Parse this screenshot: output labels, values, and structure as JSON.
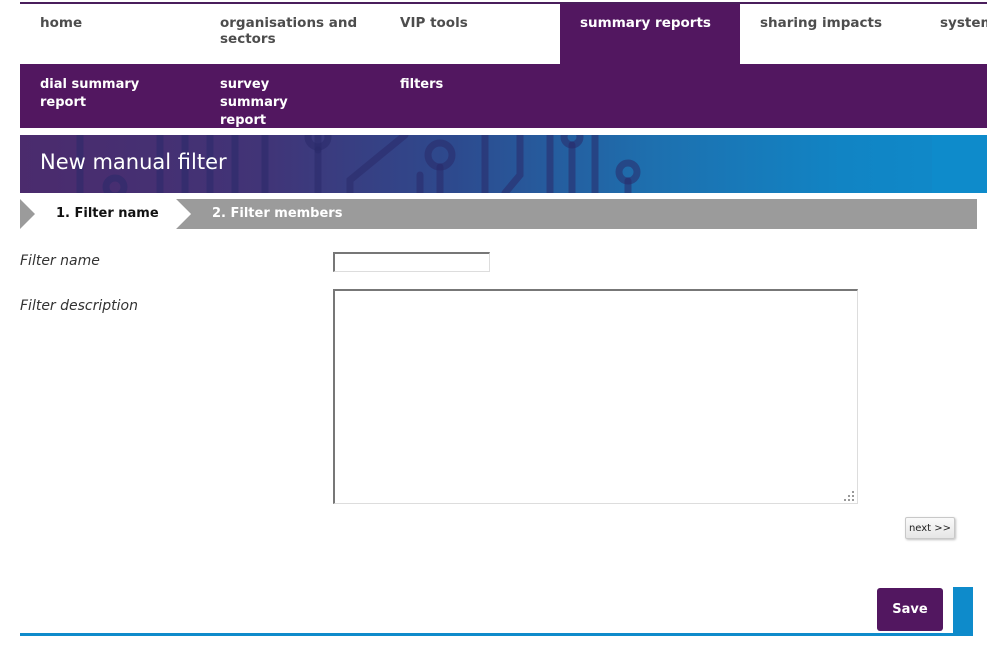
{
  "nav": {
    "items": [
      {
        "label": "home"
      },
      {
        "label": "organisations and sectors"
      },
      {
        "label": "VIP tools"
      },
      {
        "label": "summary reports",
        "active": true
      },
      {
        "label": "sharing impacts"
      },
      {
        "label": "system a"
      }
    ]
  },
  "subnav": {
    "items": [
      {
        "label": "dial summary report"
      },
      {
        "label": "survey summary report"
      },
      {
        "label": "filters"
      }
    ]
  },
  "banner": {
    "title": "New manual filter"
  },
  "steps": {
    "step1": "1. Filter name",
    "step2": "2. Filter members"
  },
  "form": {
    "name_label": "Filter name",
    "name_value": "",
    "description_label": "Filter description",
    "description_value": ""
  },
  "buttons": {
    "next_label": "next >>",
    "save_label": "Save"
  },
  "colors": {
    "brand_purple": "#521760",
    "accent_blue": "#0e8bcb",
    "step_gray": "#9b9b9b"
  }
}
